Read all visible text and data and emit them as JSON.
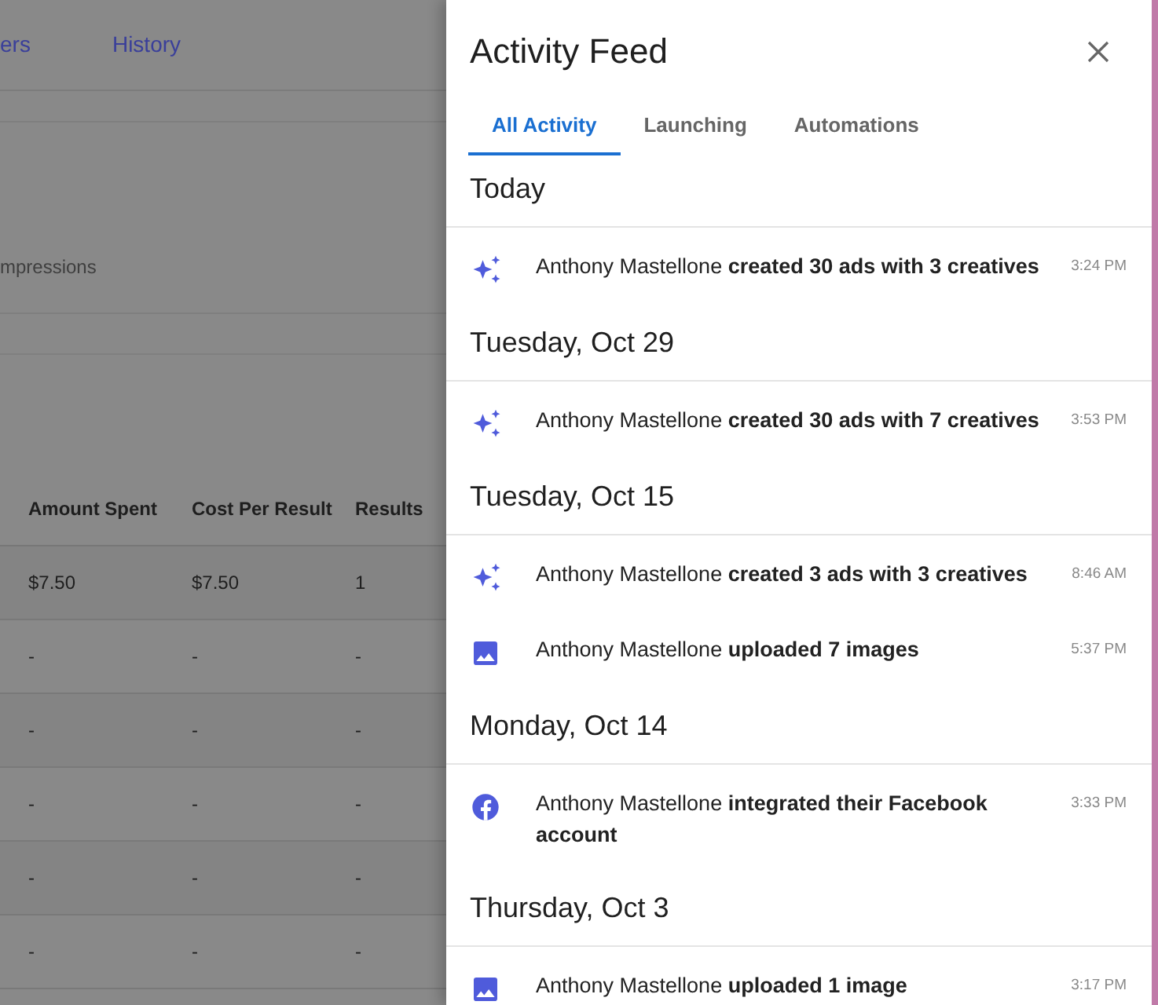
{
  "background": {
    "nav_links": [
      {
        "label": "ers"
      },
      {
        "label": "History"
      }
    ],
    "summary_label": "mpressions",
    "table": {
      "columns": [
        "Amount Spent",
        "Cost Per Result",
        "Results"
      ],
      "rows": [
        [
          "$7.50",
          "$7.50",
          "1"
        ],
        [
          "-",
          "-",
          "-"
        ],
        [
          "-",
          "-",
          "-"
        ],
        [
          "-",
          "-",
          "-"
        ],
        [
          "-",
          "-",
          "-"
        ],
        [
          "-",
          "-",
          "-"
        ]
      ]
    }
  },
  "drawer": {
    "title": "Activity Feed",
    "tabs": [
      {
        "label": "All Activity",
        "selected": true
      },
      {
        "label": "Launching",
        "selected": false
      },
      {
        "label": "Automations",
        "selected": false
      }
    ],
    "groups": [
      {
        "date": "Today",
        "items": [
          {
            "kind": "sparkle",
            "text": "Anthony Mastellone **created 30 ads with 3 creatives**",
            "time": "3:24 PM"
          }
        ]
      },
      {
        "date": "Tuesday, Oct 29",
        "items": [
          {
            "kind": "sparkle",
            "text": "Anthony Mastellone **created 30 ads with 7 creatives**",
            "time": "3:53 PM"
          }
        ]
      },
      {
        "date": "Tuesday, Oct 15",
        "items": [
          {
            "kind": "sparkle",
            "text": "Anthony Mastellone **created 3 ads with 3 creatives**",
            "time": "8:46 AM"
          },
          {
            "kind": "image",
            "text": "Anthony Mastellone **uploaded 7 images**",
            "time": "5:37 PM"
          }
        ]
      },
      {
        "date": "Monday, Oct 14",
        "items": [
          {
            "kind": "facebook",
            "text": "Anthony Mastellone **integrated their Facebook account**",
            "time": "3:33 PM"
          }
        ]
      },
      {
        "date": "Thursday, Oct 3",
        "items": [
          {
            "kind": "image",
            "text": "Anthony Mastellone **uploaded 1 image**",
            "time": "3:17 PM"
          }
        ]
      }
    ]
  }
}
